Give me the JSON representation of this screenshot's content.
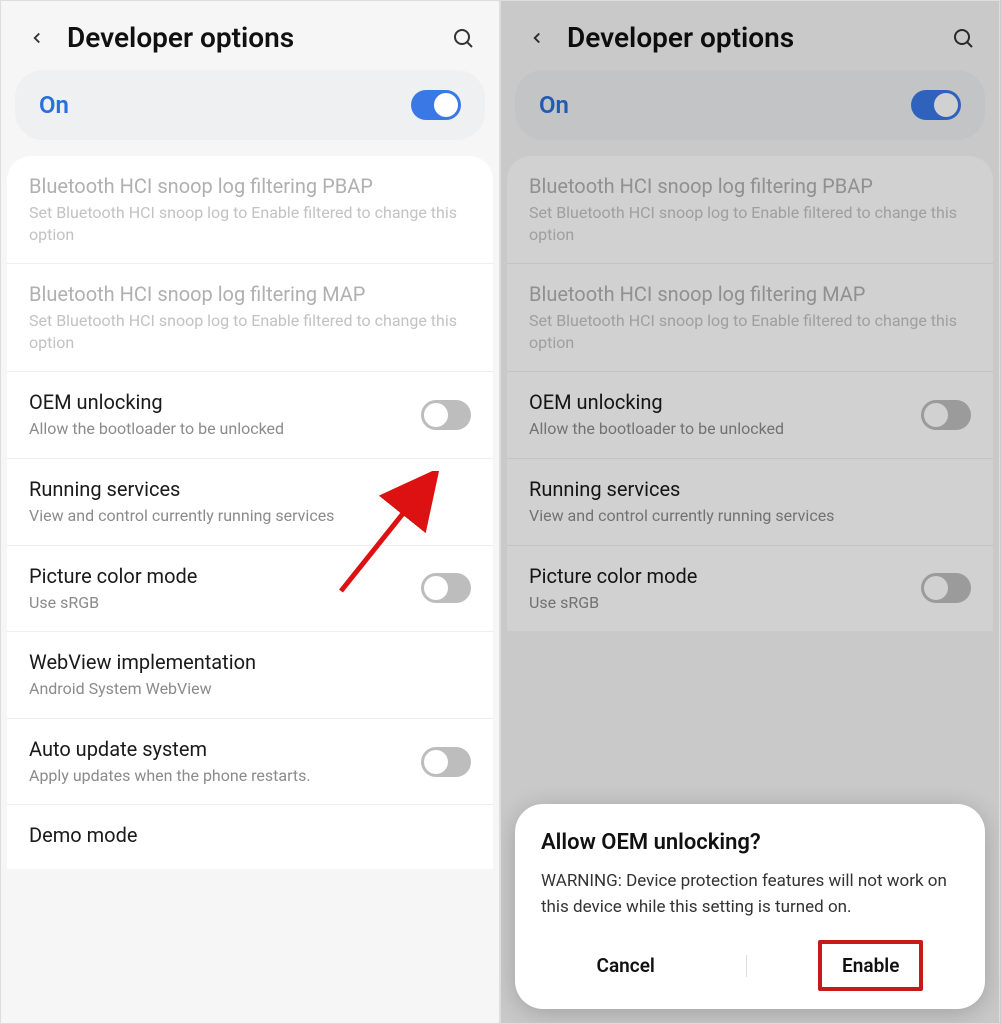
{
  "header": {
    "title": "Developer options"
  },
  "masterToggle": {
    "label": "On",
    "state": "on"
  },
  "items": [
    {
      "title": "Bluetooth HCI snoop log filtering PBAP",
      "sub": "Set Bluetooth HCI snoop log to Enable filtered to change this option",
      "disabled": true,
      "toggle": null
    },
    {
      "title": "Bluetooth HCI snoop log filtering MAP",
      "sub": "Set Bluetooth HCI snoop log to Enable filtered to change this option",
      "disabled": true,
      "toggle": null
    },
    {
      "title": "OEM unlocking",
      "sub": "Allow the bootloader to be unlocked",
      "disabled": false,
      "toggle": "off"
    },
    {
      "title": "Running services",
      "sub": "View and control currently running services",
      "disabled": false,
      "toggle": null
    },
    {
      "title": "Picture color mode",
      "sub": "Use sRGB",
      "disabled": false,
      "toggle": "off"
    },
    {
      "title": "WebView implementation",
      "sub": "Android System WebView",
      "disabled": false,
      "toggle": null
    },
    {
      "title": "Auto update system",
      "sub": "Apply updates when the phone restarts.",
      "disabled": false,
      "toggle": "off"
    },
    {
      "title": "Demo mode",
      "sub": "",
      "disabled": false,
      "toggle": null
    }
  ],
  "dialog": {
    "title": "Allow OEM unlocking?",
    "body": "WARNING: Device protection features will not work on this device while this setting is turned on.",
    "cancel": "Cancel",
    "confirm": "Enable"
  }
}
